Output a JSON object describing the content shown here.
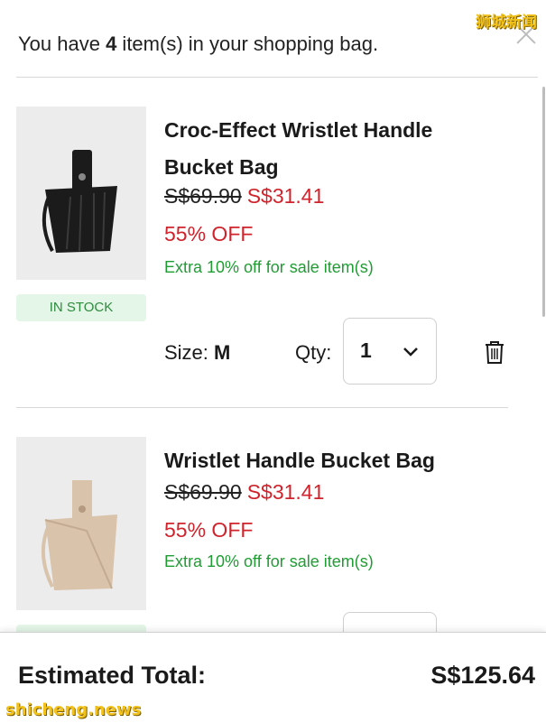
{
  "watermark": {
    "top": "狮城新闻",
    "bottom": "shicheng.news"
  },
  "header": {
    "prefix": "You have ",
    "count": "4",
    "suffix": " item(s) in your shopping bag."
  },
  "items": [
    {
      "name": "Croc-Effect Wristlet Handle Bucket Bag",
      "old_price": "S$69.90",
      "new_price": "S$31.41",
      "discount": "55% OFF",
      "extra": "Extra 10% off for sale item(s)",
      "stock": "IN STOCK",
      "size_label": "Size:",
      "size_value": "M",
      "qty_label": "Qty:",
      "qty_value": "1",
      "color": "#1b1b1b"
    },
    {
      "name": "Wristlet Handle Bucket Bag",
      "old_price": "S$69.90",
      "new_price": "S$31.41",
      "discount": "55% OFF",
      "extra": "Extra 10% off for sale item(s)",
      "color": "#d9c3ab"
    }
  ],
  "footer": {
    "total_label": "Estimated Total:",
    "total_value": "S$125.64"
  },
  "icons": {
    "close": "close-icon",
    "trash": "trash-icon",
    "chevron": "chevron-down-icon"
  },
  "colors": {
    "sale": "#d0232c",
    "extra": "#1f9d33",
    "stock_bg": "#e4f6e7"
  }
}
